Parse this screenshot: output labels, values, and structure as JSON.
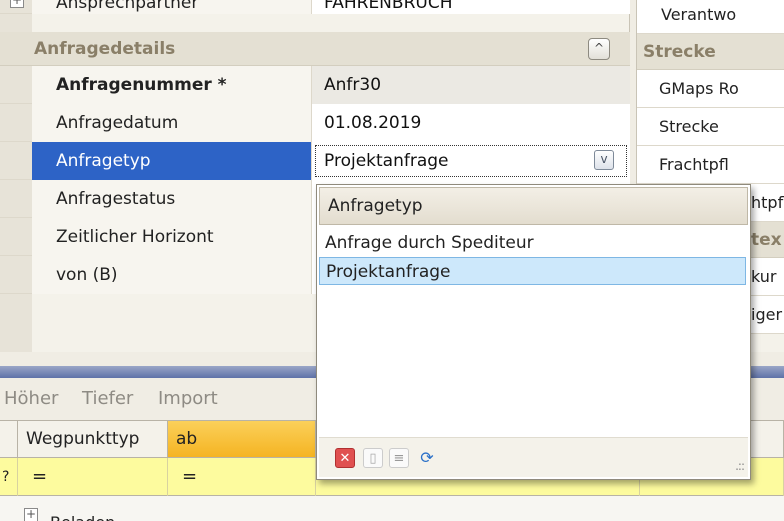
{
  "top_row": {
    "label": "Ansprechpartner",
    "value": "FAHRENBRUCH",
    "expander": "+"
  },
  "section_details": {
    "title": "Anfragedetails",
    "collapse_glyph": "^"
  },
  "properties": [
    {
      "label": "Anfragenummer *",
      "value": "Anfr30"
    },
    {
      "label": "Anfragedatum",
      "value": "01.08.2019"
    },
    {
      "label": "Anfragetyp",
      "value": "Projektanfrage",
      "dropdown_glyph": "v"
    },
    {
      "label": "Anfragestatus",
      "value": ""
    },
    {
      "label": "Zeitlicher Horizont",
      "value": ""
    },
    {
      "label": "von (B)",
      "value": ""
    }
  ],
  "right_panel": {
    "top_item": "Verantwo",
    "section": "Strecke",
    "items": [
      "GMaps Ro",
      "Strecke",
      "Frachtpfl",
      "htpfl",
      "tex",
      "kur",
      "iger"
    ]
  },
  "toolbar": {
    "higher": "Höher",
    "lower": "Tiefer",
    "import": "Import"
  },
  "lower_grid": {
    "row_marker": "?",
    "headers": [
      "Wegpunkttyp",
      "ab"
    ],
    "filter": [
      "=",
      "="
    ],
    "first_row": {
      "expander": "+",
      "label": "Beladen"
    }
  },
  "dropdown": {
    "header": "Anfragetyp",
    "options": [
      "Anfrage durch Spediteur",
      "Projektanfrage"
    ],
    "selected": "Projektanfrage",
    "footer_icons": [
      "delete-icon",
      "new-document-icon",
      "document-list-icon",
      "refresh-icon"
    ],
    "footer_glyphs": {
      "delete": "✕",
      "new_document": "▯",
      "document_list": "≡",
      "refresh": "⟳",
      "grip": ".::"
    }
  },
  "colors": {
    "selection": "#2d63c6",
    "header_orange": "#f5b422",
    "filter_yellow": "#fdfb9e",
    "popup_selected": "#cde8fb"
  }
}
